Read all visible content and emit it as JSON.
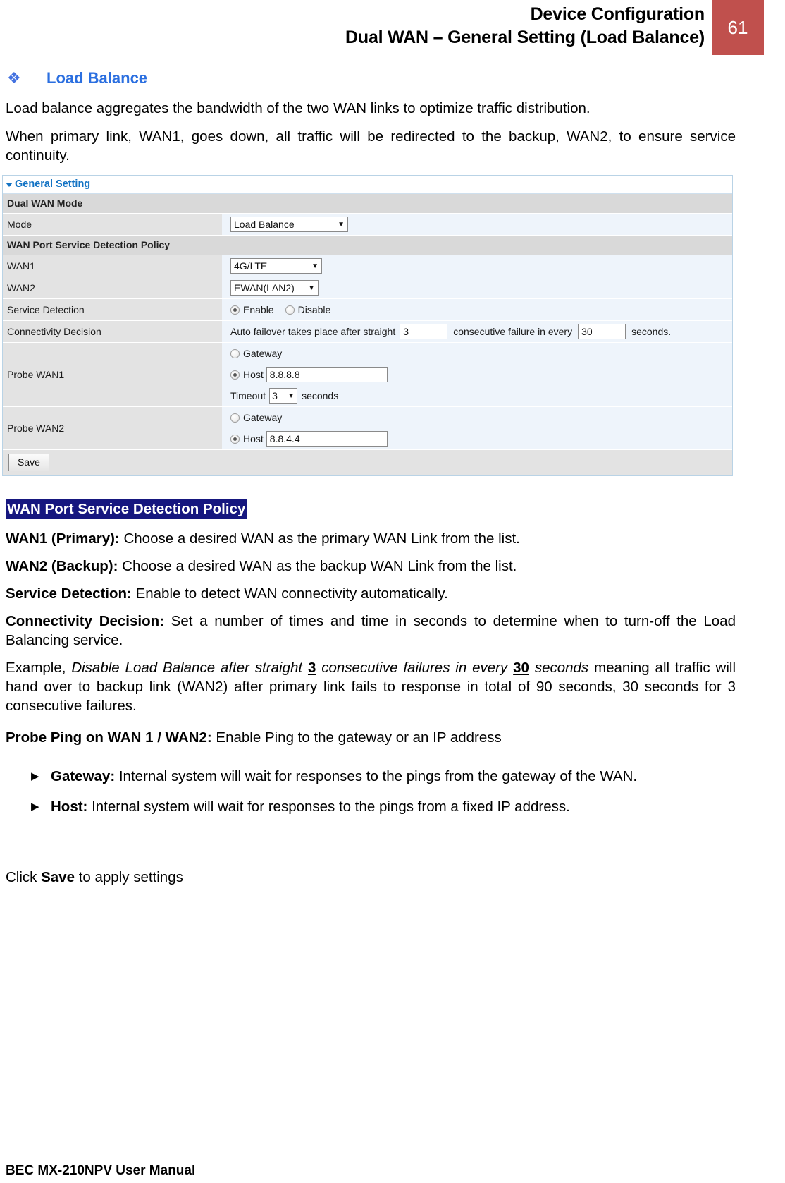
{
  "header": {
    "title_line1": "Device Configuration",
    "title_line2": "Dual WAN – General Setting (Load Balance)",
    "page_number": "61",
    "page_number_bg": "#c0504d"
  },
  "section": {
    "bullet_glyph": "❖",
    "heading": "Load Balance",
    "heading_color": "#2b6fe0",
    "intro_1": "Load balance aggregates the bandwidth of the two WAN links to optimize traffic distribution.",
    "intro_2": "When primary link, WAN1, goes down, all traffic will be redirected to the backup, WAN2, to ensure service continuity."
  },
  "ui_panel": {
    "panel_title": "General Setting",
    "panel_title_color": "#1373c4",
    "collapse_icon": "triangle-down-icon",
    "group_dual_wan_mode": "Dual WAN Mode",
    "mode": {
      "label": "Mode",
      "value": "Load Balance",
      "caret": "▼"
    },
    "group_wan_policy": "WAN Port Service Detection Policy",
    "wan1": {
      "label": "WAN1",
      "value": "4G/LTE",
      "caret": "▼"
    },
    "wan2": {
      "label": "WAN2",
      "value": "EWAN(LAN2)",
      "caret": "▼"
    },
    "service_detection": {
      "label": "Service Detection",
      "enable_label": "Enable",
      "disable_label": "Disable",
      "selected": "Enable"
    },
    "connectivity_decision": {
      "label": "Connectivity Decision",
      "text_before": "Auto failover takes place after straight",
      "failures_value": "3",
      "text_middle": "consecutive failure in every",
      "seconds_value": "30",
      "text_after": "seconds."
    },
    "probe_wan1": {
      "label": "Probe WAN1",
      "gateway_label": "Gateway",
      "host_label": "Host",
      "host_value": "8.8.8.8",
      "selected": "Host",
      "timeout_label": "Timeout",
      "timeout_value": "3",
      "timeout_caret": "▼",
      "timeout_unit": "seconds"
    },
    "probe_wan2": {
      "label": "Probe WAN2",
      "gateway_label": "Gateway",
      "host_label": "Host",
      "host_value": "8.8.4.4",
      "selected": "Host"
    },
    "save_button": "Save"
  },
  "doc": {
    "policy_heading": "WAN Port Service Detection Policy",
    "policy_heading_bg": "#16177f",
    "wan1_primary_lead": "WAN1 (Primary):",
    "wan1_primary_body": " Choose a desired WAN as the primary WAN Link from the list.",
    "wan2_backup_lead": "WAN2 (Backup):",
    "wan2_backup_body": " Choose a desired WAN as the backup WAN Link from the list.",
    "service_detection_lead": "Service Detection:",
    "service_detection_body": " Enable to detect WAN connectivity automatically.",
    "connectivity_lead": "Connectivity Decision:",
    "connectivity_body": " Set a  number of times and time in seconds to determine when to turn-off the Load Balancing service.",
    "example_prefix": "Example, ",
    "example_italic_1": "Disable Load Balance after straight ",
    "example_num_1": "3",
    "example_italic_2": " consecutive failures in every ",
    "example_num_2": "30",
    "example_italic_3": " seconds",
    "example_tail": " meaning all traffic will hand over to backup link (WAN2) after primary link fails to response in total of 90 seconds, 30 seconds for 3 consecutive failures.",
    "probe_ping_lead": "Probe Ping on WAN 1 / WAN2:",
    "probe_ping_body": " Enable Ping to the gateway or an IP address",
    "bullet_glyph": "▶",
    "bullets": [
      {
        "lead": "Gateway:",
        "body": " Internal system will wait for responses to the pings from the gateway of the WAN."
      },
      {
        "lead": "Host:",
        "body": " Internal system will wait for responses to the pings from a fixed IP address."
      }
    ],
    "click_save_prefix": "Click ",
    "click_save_bold": "Save",
    "click_save_suffix": " to apply settings"
  },
  "footer": {
    "text": "BEC MX-210NPV User Manual"
  }
}
